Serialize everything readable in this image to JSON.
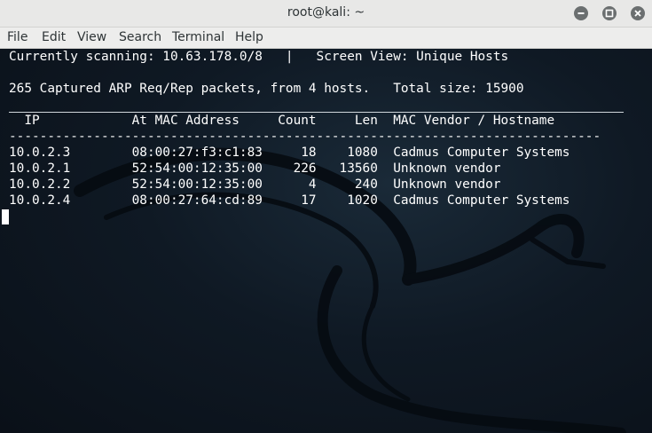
{
  "window": {
    "title": "root@kali: ~"
  },
  "controls": {
    "minimize_icon": "minimize-icon",
    "maximize_icon": "maximize-icon",
    "close_icon": "close-icon"
  },
  "menu": [
    "File",
    "Edit",
    "View",
    "Search",
    "Terminal",
    "Help"
  ],
  "terminal": {
    "status_line": "Currently scanning: 10.63.178.0/8   |   Screen View: Unique Hosts",
    "summary_line": "265 Captured ARP Req/Rep packets, from 4 hosts.   Total size: 15900",
    "header_line": "  IP            At MAC Address     Count     Len  MAC Vendor / Hostname",
    "separator_line": "-----------------------------------------------------------------------------",
    "rows": [
      "10.0.2.3        08:00:27:f3:c1:83     18    1080  Cadmus Computer Systems",
      "10.0.2.1        52:54:00:12:35:00    226   13560  Unknown vendor",
      "10.0.2.2        52:54:00:12:35:00      4     240  Unknown vendor",
      "10.0.2.4        08:00:27:64:cd:89     17    1020  Cadmus Computer Systems"
    ]
  },
  "colors": {
    "terminal_bg": "#0b121b",
    "text": "#ffffff",
    "titlebar": "#e8e8e7"
  }
}
